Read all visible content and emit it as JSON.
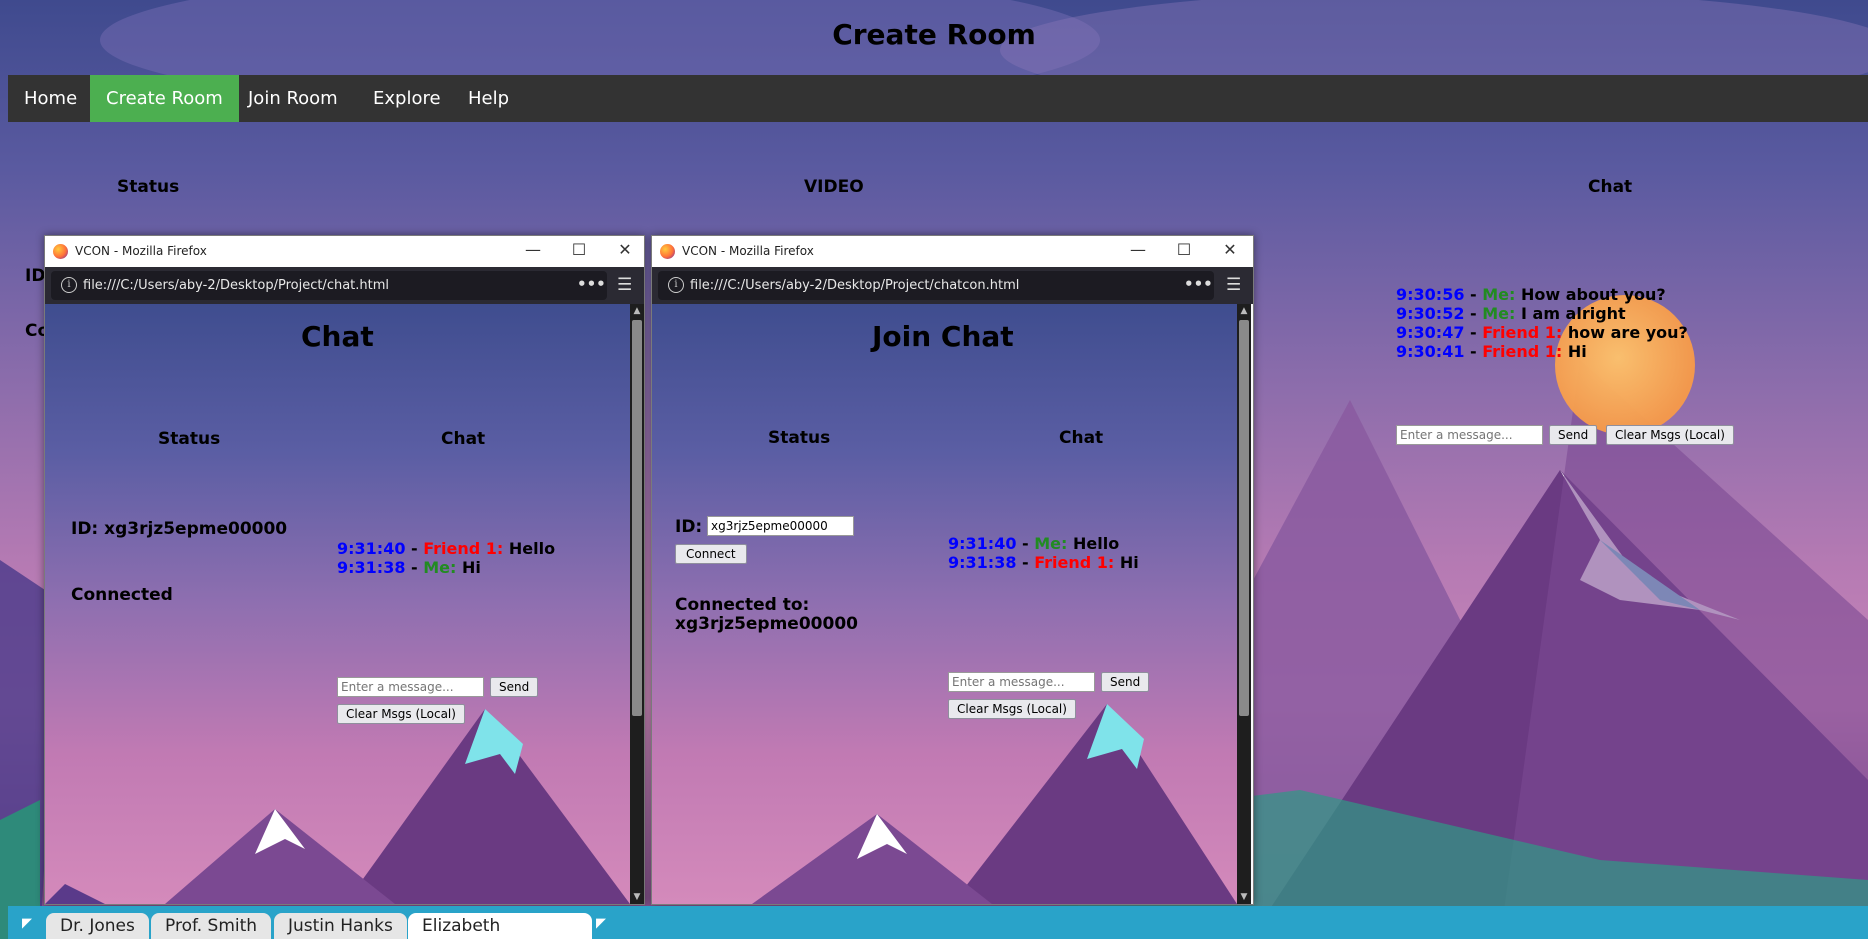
{
  "page": {
    "title": "Create Room",
    "nav": [
      "Home",
      "Create Room",
      "Join Room",
      "Explore",
      "Help"
    ],
    "active_nav": "Create Room",
    "columns": {
      "status": "Status",
      "video": "VIDEO",
      "chat": "Chat"
    },
    "partial_labels": {
      "id": "ID",
      "co": "Co"
    },
    "chat_log": [
      {
        "time": "9:30:56",
        "sep": " - ",
        "who": "Me:",
        "who_type": "me",
        "text": " How about you?"
      },
      {
        "time": "9:30:52",
        "sep": " - ",
        "who": "Me:",
        "who_type": "me",
        "text": " I am alright"
      },
      {
        "time": "9:30:47",
        "sep": " - ",
        "who": "Friend 1:",
        "who_type": "friend",
        "text": " how are you?"
      },
      {
        "time": "9:30:41",
        "sep": " - ",
        "who": "Friend 1:",
        "who_type": "friend",
        "text": " Hi"
      }
    ],
    "message_placeholder": "Enter a message...",
    "send_label": "Send",
    "clear_label": "Clear Msgs (Local)"
  },
  "window1": {
    "title": "VCON - Mozilla Firefox",
    "url": "file:///C:/Users/aby-2/Desktop/Project/chat.html",
    "heading": "Chat",
    "status_heading": "Status",
    "chat_heading": "Chat",
    "id_text": "ID: xg3rjz5epme00000",
    "status_text": "Connected",
    "chat_log": [
      {
        "time": "9:31:40",
        "sep": " - ",
        "who": "Friend 1:",
        "who_type": "friend",
        "text": " Hello"
      },
      {
        "time": "9:31:38",
        "sep": " - ",
        "who": "Me:",
        "who_type": "me",
        "text": " Hi"
      }
    ],
    "message_placeholder": "Enter a message...",
    "send_label": "Send",
    "clear_label": "Clear Msgs (Local)"
  },
  "window2": {
    "title": "VCON - Mozilla Firefox",
    "url": "file:///C:/Users/aby-2/Desktop/Project/chatcon.html",
    "heading": "Join Chat",
    "status_heading": "Status",
    "chat_heading": "Chat",
    "id_label": "ID:",
    "id_value": "xg3rjz5epme00000",
    "connect_label": "Connect",
    "connected_to_label": "Connected to:",
    "connected_to_value": "xg3rjz5epme00000",
    "chat_log": [
      {
        "time": "9:31:40",
        "sep": " - ",
        "who": "Me:",
        "who_type": "me",
        "text": " Hello"
      },
      {
        "time": "9:31:38",
        "sep": " - ",
        "who": "Friend 1:",
        "who_type": "friend",
        "text": " Hi"
      }
    ],
    "message_placeholder": "Enter a message...",
    "send_label": "Send",
    "clear_label": "Clear Msgs (Local)"
  },
  "taskbar": {
    "tabs": [
      "Dr. Jones",
      "Prof. Smith",
      "Justin Hanks",
      "Elizabeth"
    ],
    "active_tab": "Elizabeth"
  },
  "colors": {
    "timestamp": "#0000ff",
    "me": "#228b22",
    "friend": "#ff0000",
    "nav_bg": "#333333",
    "nav_active": "#4caf50",
    "taskbar": "#29a3c9"
  }
}
